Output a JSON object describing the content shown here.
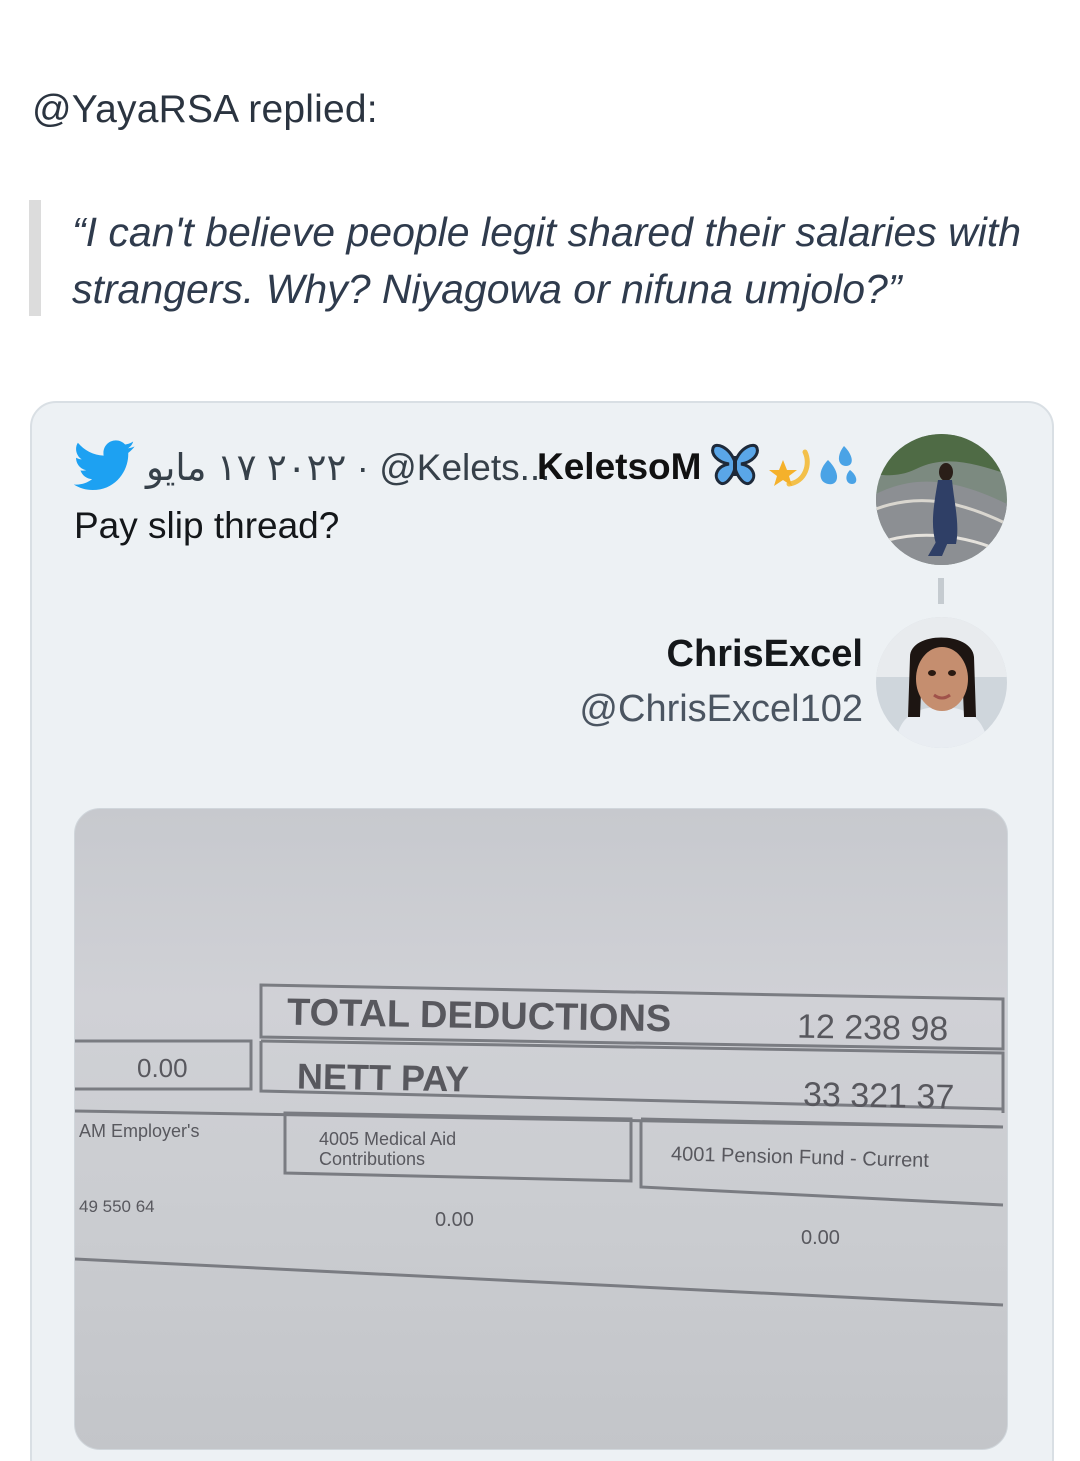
{
  "reply_header": "@YayaRSA replied:",
  "quote": "“I can't believe people legit shared their salaries with strangers. Why? Niyagowa or nifuna umjolo?”",
  "colors": {
    "twitter_blue": "#1DA1F2",
    "card_bg": "#edf1f4",
    "quote_bar": "#dcdcdc"
  },
  "embedded_tweet": {
    "platform_icon": "twitter-bird-icon",
    "meta": "٢٠٢٢ ١٧ مايو · @Kelets...",
    "author_name": "KeletsoM",
    "name_emojis": [
      "butterfly-icon",
      "dizzy-star-icon",
      "sweat-droplets-icon"
    ],
    "text": "Pay slip thread?",
    "reply_author": {
      "name": "ChrisExcel",
      "handle": "@ChrisExcel102"
    },
    "payslip": {
      "total_deductions_label": "TOTAL DEDUCTIONS",
      "total_deductions_value": "12 238 98",
      "left_value": "0.00",
      "nett_pay_label": "NETT PAY",
      "nett_pay_value": "33 321 37",
      "col1_label": "AM Employer's",
      "col1_value": "49 550 64",
      "col2_label": "4005 Medical Aid Contributions",
      "col2_value": "0.00",
      "col3_label": "4001 Pension Fund - Current",
      "col3_value": "0.00"
    }
  }
}
